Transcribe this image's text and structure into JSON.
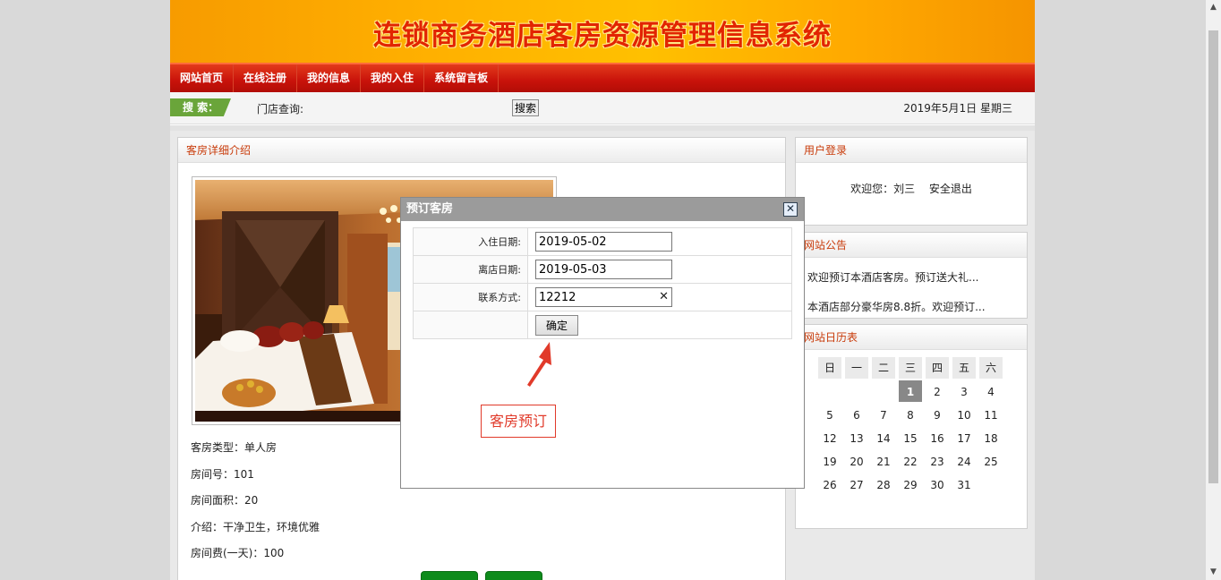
{
  "header": {
    "title": "连锁商务酒店客房资源管理信息系统"
  },
  "nav": {
    "items": [
      "网站首页",
      "在线注册",
      "我的信息",
      "我的入住",
      "系统留言板"
    ]
  },
  "search": {
    "tag": "搜 索：",
    "store_label": "门店查询:",
    "button": "搜索",
    "date": "2019年5月1日 星期三"
  },
  "room": {
    "panel_title": "客房详细介绍",
    "type": "客房类型：单人房",
    "number": "房间号：101",
    "area": "房间面积：20",
    "intro": "介绍：干净卫生，环境优雅",
    "price": "房间费(一天)：100"
  },
  "login": {
    "title": "用户登录",
    "welcome": "欢迎您：刘三",
    "logout": "安全退出"
  },
  "notice": {
    "title": "网站公告",
    "items": [
      "欢迎预订本酒店客房。预订送大礼...",
      "本酒店部分豪华房8.8折。欢迎预订..."
    ]
  },
  "calendar": {
    "title": "网站日历表",
    "weekdays": [
      "日",
      "一",
      "二",
      "三",
      "四",
      "五",
      "六"
    ],
    "weeks": [
      [
        "",
        "",
        "",
        "1",
        "2",
        "3",
        "4"
      ],
      [
        "5",
        "6",
        "7",
        "8",
        "9",
        "10",
        "11"
      ],
      [
        "12",
        "13",
        "14",
        "15",
        "16",
        "17",
        "18"
      ],
      [
        "19",
        "20",
        "21",
        "22",
        "23",
        "24",
        "25"
      ],
      [
        "26",
        "27",
        "28",
        "29",
        "30",
        "31",
        ""
      ]
    ],
    "today": "1"
  },
  "dialog": {
    "title": "预订客房",
    "close": "✕",
    "checkin_label": "入住日期:",
    "checkin_value": "2019-05-02",
    "checkout_label": "离店日期:",
    "checkout_value": "2019-05-03",
    "contact_label": "联系方式:",
    "contact_value": "12212",
    "confirm": "确定"
  },
  "annotation": {
    "text": "客房预订"
  },
  "colors": {
    "nav_red": "#c8120a",
    "accent_orange": "#c83b0a",
    "search_green": "#6aa53a",
    "annotation_red": "#e13a2a"
  }
}
